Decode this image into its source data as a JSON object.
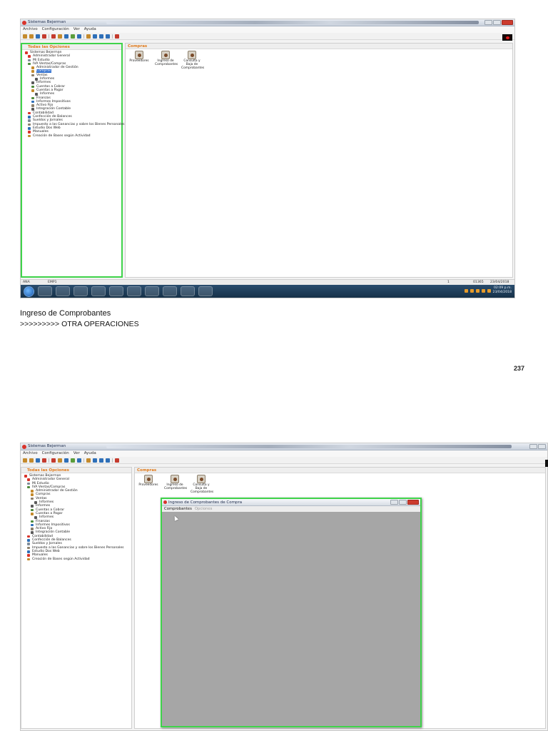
{
  "app": {
    "window_title": "Sistemas Bejerman",
    "menu": [
      "Archivo",
      "Configuración",
      "Ver",
      "Ayuda"
    ]
  },
  "left_panel": {
    "header": "Todas las Opciones",
    "tree": [
      {
        "label": "Sistemas Bejerman",
        "level": 0
      },
      {
        "label": "Administrador General",
        "level": 1
      },
      {
        "label": "Mi Estudio",
        "level": 1
      },
      {
        "label": "IVA Ventas/Compras",
        "level": 1
      },
      {
        "label": "Administrador de Gestión",
        "level": 2
      },
      {
        "label": "Compras",
        "level": 2
      },
      {
        "label": "Ventas",
        "level": 2
      },
      {
        "label": "Informes",
        "level": 3
      },
      {
        "label": "Informes",
        "level": 2
      },
      {
        "label": "Cuentas a Cobrar",
        "level": 2
      },
      {
        "label": "Cuentas a Pagar",
        "level": 2
      },
      {
        "label": "Informes",
        "level": 3
      },
      {
        "label": "Finanzas",
        "level": 2
      },
      {
        "label": "Informes Impositivos",
        "level": 2
      },
      {
        "label": "Activo Fijo",
        "level": 2
      },
      {
        "label": "Integración Contable",
        "level": 2
      },
      {
        "label": "Contabilidad",
        "level": 1
      },
      {
        "label": "Confección de Balances",
        "level": 1
      },
      {
        "label": "Sueldos y Jornales",
        "level": 1
      },
      {
        "label": "Impuesto a las Ganancias y sobre los Bienes Personales",
        "level": 1
      },
      {
        "label": "Estudio Dos Web",
        "level": 1
      },
      {
        "label": "Manuales",
        "level": 1
      },
      {
        "label": "Creación de Bases según Actividad",
        "level": 1
      }
    ],
    "selected_index": 5
  },
  "right_panel": {
    "header": "Compras",
    "icons": [
      {
        "label": "Proveedores",
        "icon": "suppliers-icon"
      },
      {
        "label": "Ingreso de Comprobantes",
        "icon": "voucher-entry-icon"
      },
      {
        "label": "Consulta y Baja de Comprobantes",
        "icon": "voucher-query-icon"
      }
    ]
  },
  "status": {
    "user": "ANA",
    "company": "EMP1",
    "page": "1",
    "code": "01365",
    "date": "23/04/2018"
  },
  "taskbar": {
    "time": "02:09 p.m.",
    "date": "23/04/2018"
  },
  "dialog": {
    "title": "Ingreso de Comprobantes de Compra",
    "menu": [
      {
        "label": "Comprobantes",
        "enabled": true
      },
      {
        "label": "Opciones",
        "enabled": false
      }
    ]
  },
  "caption": {
    "title": "Ingreso de Comprobantes",
    "subtitle": ">>>>>>>>> OTRA OPERACIONES"
  },
  "page_number": "237",
  "colors": {
    "highlight_border": "#3fd34a",
    "panel_header_text": "#e07a1a",
    "selection": "#2f6fcf",
    "dialog_body": "#a6a6a6"
  }
}
